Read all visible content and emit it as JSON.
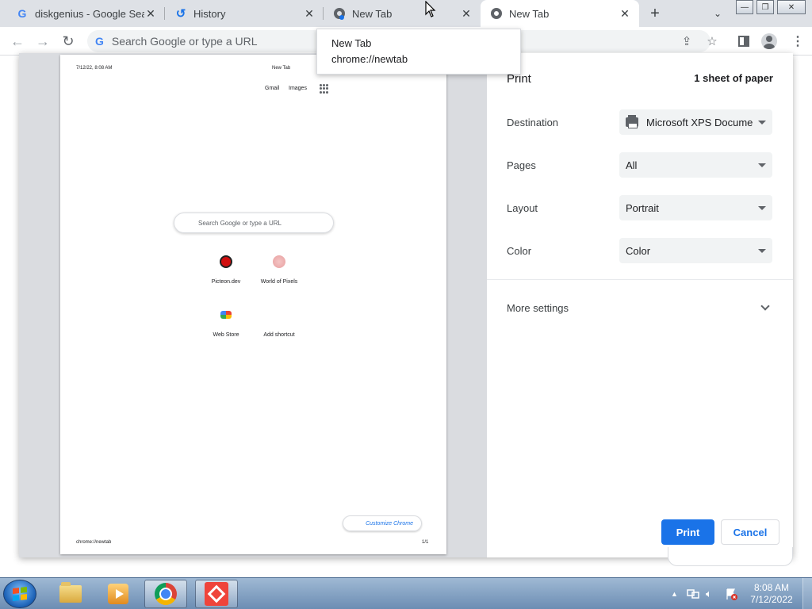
{
  "tabs": [
    {
      "title": "diskgenius - Google Search",
      "favicon": "google-g-icon"
    },
    {
      "title": "History",
      "favicon": "history-icon"
    },
    {
      "title": "New Tab",
      "favicon": "chrome-icon",
      "loading": true
    },
    {
      "title": "New Tab",
      "favicon": "chrome-icon",
      "active": true
    }
  ],
  "toolbar": {
    "omnibox_placeholder": "Search Google or type a URL"
  },
  "tooltip": {
    "title": "New Tab",
    "url": "chrome://newtab"
  },
  "preview": {
    "header_date": "7/12/22, 8:08 AM",
    "header_title": "New Tab",
    "gmail": "Gmail",
    "images": "Images",
    "search_placeholder": "Search Google or type a URL",
    "shortcuts": [
      {
        "label": "Picteon.dev",
        "icon": "picteon-icon"
      },
      {
        "label": "World of Pixels",
        "icon": "world-of-pixels-icon"
      },
      {
        "label": "Web Store",
        "icon": "web-store-icon"
      },
      {
        "label": "Add shortcut",
        "icon": "add-shortcut-icon"
      }
    ],
    "customize": "Customize Chrome",
    "footer_url": "chrome://newtab",
    "footer_page": "1/1"
  },
  "print": {
    "title": "Print",
    "sheets": "1 sheet of paper",
    "destination_label": "Destination",
    "destination_value": "Microsoft XPS Document Writer",
    "pages_label": "Pages",
    "pages_value": "All",
    "layout_label": "Layout",
    "layout_value": "Portrait",
    "color_label": "Color",
    "color_value": "Color",
    "more_settings": "More settings",
    "print_button": "Print",
    "cancel_button": "Cancel"
  },
  "taskbar": {
    "apps": [
      "file-explorer-icon",
      "media-player-icon",
      "chrome-icon",
      "anydesk-icon"
    ],
    "time": "8:08 AM",
    "date": "7/12/2022"
  },
  "colors": {
    "accent": "#1a73e8",
    "tab_strip": "#dee1e6",
    "preview_bg": "#dadce0"
  }
}
